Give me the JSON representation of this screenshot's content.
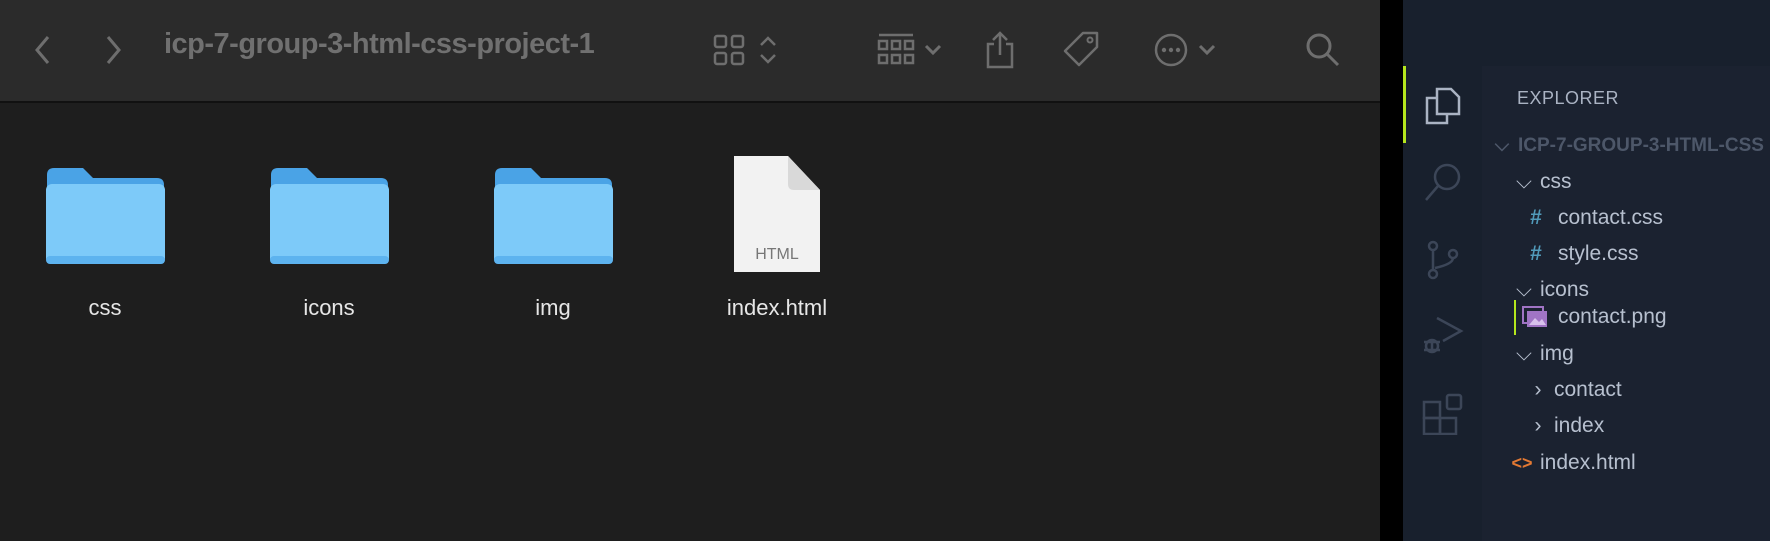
{
  "finder": {
    "title": "icp-7-group-3-html-css-project-1",
    "items": [
      {
        "name": "css",
        "kind": "folder"
      },
      {
        "name": "icons",
        "kind": "folder"
      },
      {
        "name": "img",
        "kind": "folder"
      },
      {
        "name": "index.html",
        "kind": "file",
        "badge": "HTML"
      }
    ],
    "folder_color": "#7dcaf9"
  },
  "vscode": {
    "explorer_label": "EXPLORER",
    "root": "ICP-7-GROUP-3-HTML-CSS",
    "tree": [
      {
        "label": "css",
        "type": "folder",
        "expanded": true
      },
      {
        "label": "contact.css",
        "type": "css"
      },
      {
        "label": "style.css",
        "type": "css"
      },
      {
        "label": "icons",
        "type": "folder",
        "expanded": true
      },
      {
        "label": "contact.png",
        "type": "image"
      },
      {
        "label": "img",
        "type": "folder",
        "expanded": true
      },
      {
        "label": "contact",
        "type": "folder",
        "expanded": false
      },
      {
        "label": "index",
        "type": "folder",
        "expanded": false
      },
      {
        "label": "index.html",
        "type": "html"
      }
    ],
    "accent": "#b5e61d"
  }
}
